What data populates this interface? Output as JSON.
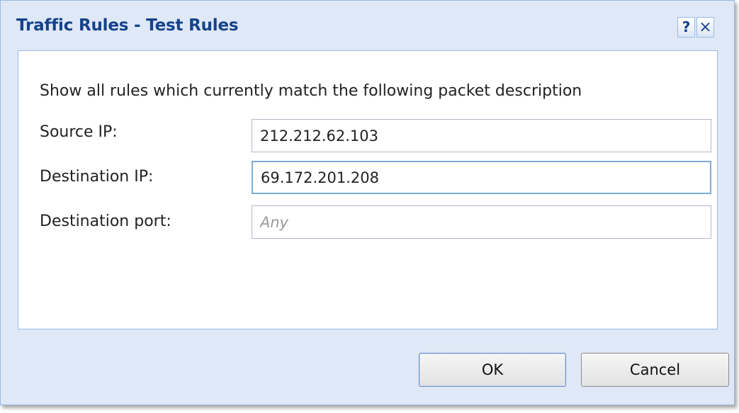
{
  "window": {
    "title": "Traffic Rules - Test Rules",
    "help_label": "?",
    "close_label": "×"
  },
  "form": {
    "description": "Show all rules which currently match the following packet description",
    "source_ip": {
      "label": "Source IP:",
      "value": "212.212.62.103",
      "placeholder": ""
    },
    "destination_ip": {
      "label": "Destination IP:",
      "value": "69.172.201.208",
      "placeholder": ""
    },
    "destination_port": {
      "label": "Destination port:",
      "value": "",
      "placeholder": "Any"
    }
  },
  "buttons": {
    "ok_label": "OK",
    "cancel_label": "Cancel"
  },
  "icons": {
    "help": "help-icon",
    "close": "close-icon"
  },
  "colors": {
    "title": "#15428b",
    "frame": "#dfe8f6",
    "border": "#99bbe8",
    "focus_border": "#7eadd9"
  }
}
